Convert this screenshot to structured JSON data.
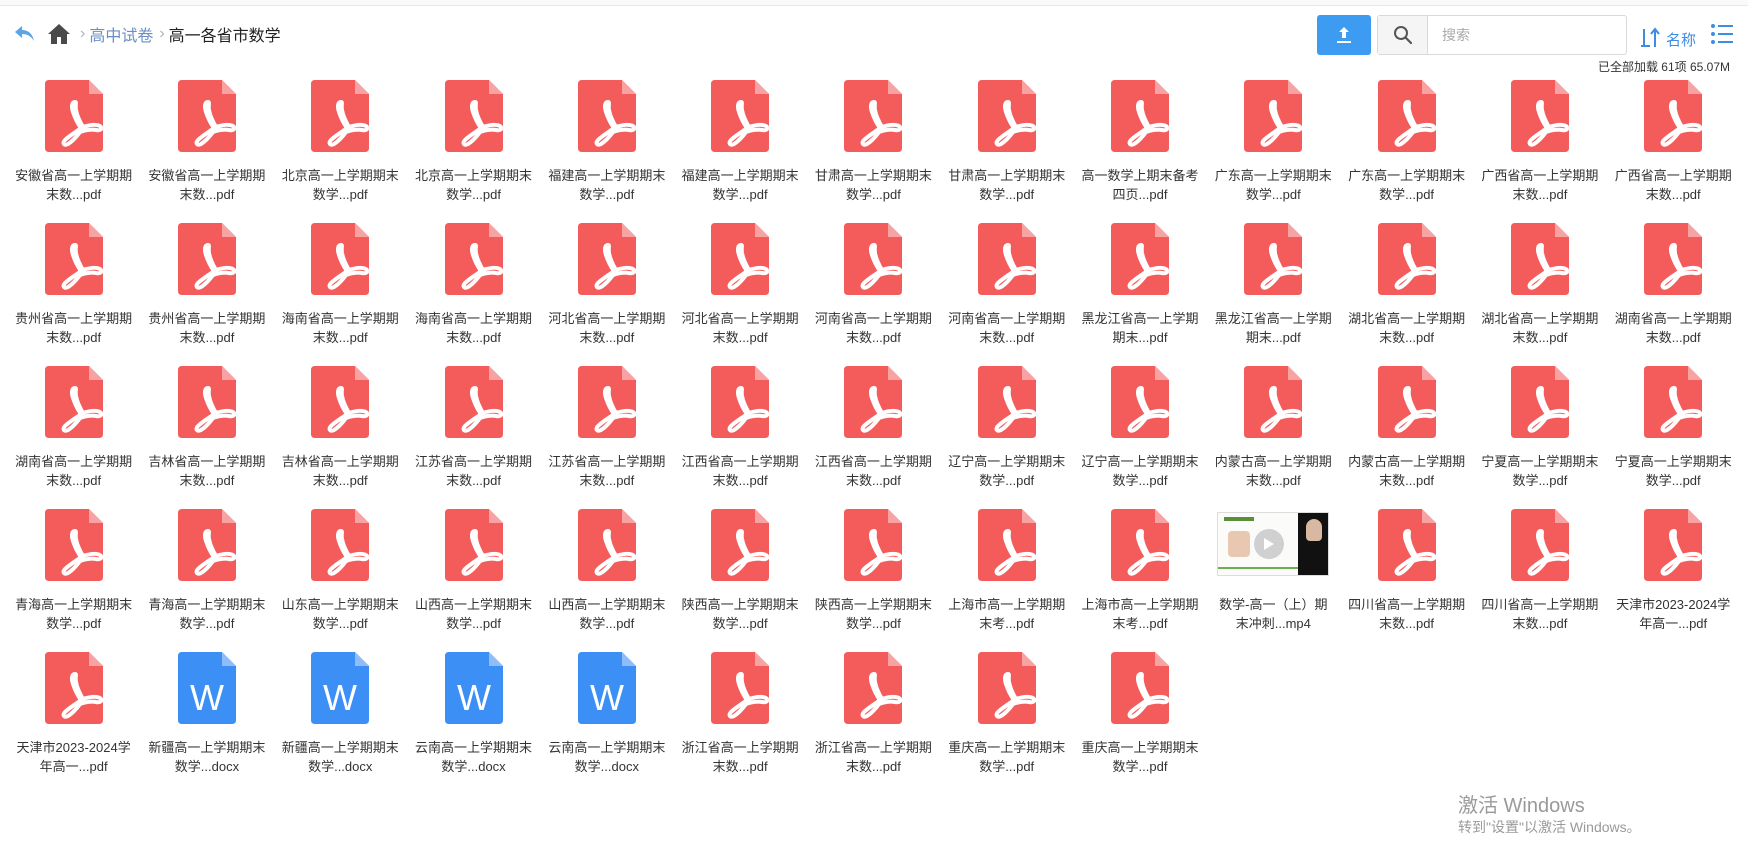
{
  "breadcrumb": {
    "parent": "高中试卷",
    "current": "高一各省市数学"
  },
  "toolbar": {
    "search_placeholder": "搜索",
    "sort_label": "名称"
  },
  "status": "已全部加载 61项 65.07M",
  "colors": {
    "pdf": "#f45b5b",
    "pdf_fold": "#f8a3a3",
    "doc": "#3c8ff5",
    "doc_fold": "#8fbdf9",
    "accent": "#3d9cf2"
  },
  "files": [
    {
      "name": "安徽省高一上学期期末数...pdf",
      "type": "pdf"
    },
    {
      "name": "安徽省高一上学期期末数...pdf",
      "type": "pdf"
    },
    {
      "name": "北京高一上学期期末数学...pdf",
      "type": "pdf"
    },
    {
      "name": "北京高一上学期期末数学...pdf",
      "type": "pdf"
    },
    {
      "name": "福建高一上学期期末数学...pdf",
      "type": "pdf"
    },
    {
      "name": "福建高一上学期期末数学...pdf",
      "type": "pdf"
    },
    {
      "name": "甘肃高一上学期期末数学...pdf",
      "type": "pdf"
    },
    {
      "name": "甘肃高一上学期期末数学...pdf",
      "type": "pdf"
    },
    {
      "name": "高一数学上期末备考四页...pdf",
      "type": "pdf"
    },
    {
      "name": "广东高一上学期期末数学...pdf",
      "type": "pdf"
    },
    {
      "name": "广东高一上学期期末数学...pdf",
      "type": "pdf"
    },
    {
      "name": "广西省高一上学期期末数...pdf",
      "type": "pdf"
    },
    {
      "name": "广西省高一上学期期末数...pdf",
      "type": "pdf"
    },
    {
      "name": "贵州省高一上学期期末数...pdf",
      "type": "pdf"
    },
    {
      "name": "贵州省高一上学期期末数...pdf",
      "type": "pdf"
    },
    {
      "name": "海南省高一上学期期末数...pdf",
      "type": "pdf"
    },
    {
      "name": "海南省高一上学期期末数...pdf",
      "type": "pdf"
    },
    {
      "name": "河北省高一上学期期末数...pdf",
      "type": "pdf"
    },
    {
      "name": "河北省高一上学期期末数...pdf",
      "type": "pdf"
    },
    {
      "name": "河南省高一上学期期末数...pdf",
      "type": "pdf"
    },
    {
      "name": "河南省高一上学期期末数...pdf",
      "type": "pdf"
    },
    {
      "name": "黑龙江省高一上学期期末...pdf",
      "type": "pdf"
    },
    {
      "name": "黑龙江省高一上学期期末...pdf",
      "type": "pdf"
    },
    {
      "name": "湖北省高一上学期期末数...pdf",
      "type": "pdf"
    },
    {
      "name": "湖北省高一上学期期末数...pdf",
      "type": "pdf"
    },
    {
      "name": "湖南省高一上学期期末数...pdf",
      "type": "pdf"
    },
    {
      "name": "湖南省高一上学期期末数...pdf",
      "type": "pdf"
    },
    {
      "name": "吉林省高一上学期期末数...pdf",
      "type": "pdf"
    },
    {
      "name": "吉林省高一上学期期末数...pdf",
      "type": "pdf"
    },
    {
      "name": "江苏省高一上学期期末数...pdf",
      "type": "pdf"
    },
    {
      "name": "江苏省高一上学期期末数...pdf",
      "type": "pdf"
    },
    {
      "name": "江西省高一上学期期末数...pdf",
      "type": "pdf"
    },
    {
      "name": "江西省高一上学期期末数...pdf",
      "type": "pdf"
    },
    {
      "name": "辽宁高一上学期期末数学...pdf",
      "type": "pdf"
    },
    {
      "name": "辽宁高一上学期期末数学...pdf",
      "type": "pdf"
    },
    {
      "name": "内蒙古高一上学期期末数...pdf",
      "type": "pdf"
    },
    {
      "name": "内蒙古高一上学期期末数...pdf",
      "type": "pdf"
    },
    {
      "name": "宁夏高一上学期期末数学...pdf",
      "type": "pdf"
    },
    {
      "name": "宁夏高一上学期期末数学...pdf",
      "type": "pdf"
    },
    {
      "name": "青海高一上学期期末数学...pdf",
      "type": "pdf"
    },
    {
      "name": "青海高一上学期期末数学...pdf",
      "type": "pdf"
    },
    {
      "name": "山东高一上学期期末数学...pdf",
      "type": "pdf"
    },
    {
      "name": "山西高一上学期期末数学...pdf",
      "type": "pdf"
    },
    {
      "name": "山西高一上学期期末数学...pdf",
      "type": "pdf"
    },
    {
      "name": "陕西高一上学期期末数学...pdf",
      "type": "pdf"
    },
    {
      "name": "陕西高一上学期期末数学...pdf",
      "type": "pdf"
    },
    {
      "name": "上海市高一上学期期末考...pdf",
      "type": "pdf"
    },
    {
      "name": "上海市高一上学期期末考...pdf",
      "type": "pdf"
    },
    {
      "name": "数学-高一（上）期末冲刺...mp4",
      "type": "mp4"
    },
    {
      "name": "四川省高一上学期期末数...pdf",
      "type": "pdf"
    },
    {
      "name": "四川省高一上学期期末数...pdf",
      "type": "pdf"
    },
    {
      "name": "天津市2023-2024学年高一...pdf",
      "type": "pdf"
    },
    {
      "name": "天津市2023-2024学年高一...pdf",
      "type": "pdf"
    },
    {
      "name": "新疆高一上学期期末数学...docx",
      "type": "docx"
    },
    {
      "name": "新疆高一上学期期末数学...docx",
      "type": "docx"
    },
    {
      "name": "云南高一上学期期末数学...docx",
      "type": "docx"
    },
    {
      "name": "云南高一上学期期末数学...docx",
      "type": "docx"
    },
    {
      "name": "浙江省高一上学期期末数...pdf",
      "type": "pdf"
    },
    {
      "name": "浙江省高一上学期期末数...pdf",
      "type": "pdf"
    },
    {
      "name": "重庆高一上学期期末数学...pdf",
      "type": "pdf"
    },
    {
      "name": "重庆高一上学期期末数学...pdf",
      "type": "pdf"
    }
  ],
  "watermark": {
    "title": "激活 Windows",
    "subtitle": "转到\"设置\"以激活 Windows。"
  }
}
